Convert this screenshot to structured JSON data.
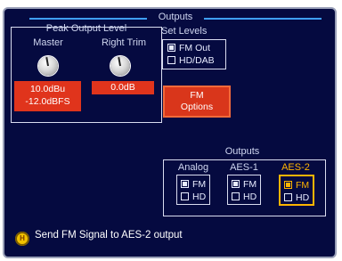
{
  "panel": {
    "title": "Outputs",
    "peak": {
      "title": "Peak Output Level",
      "master_label": "Master",
      "right_trim_label": "Right Trim",
      "master_dbu": "10.0dBu",
      "master_dbfs": "-12.0dBFS",
      "right_trim_value": "0.0dB"
    },
    "set_levels": {
      "title": "Set Levels",
      "options": [
        {
          "label": "FM Out",
          "checked": true
        },
        {
          "label": "HD/DAB",
          "checked": false
        }
      ]
    },
    "fm_options": {
      "line1": "FM",
      "line2": "Options"
    },
    "outputs": {
      "title": "Outputs",
      "columns": [
        {
          "label": "Analog",
          "fm": true,
          "hd": false,
          "selected": false
        },
        {
          "label": "AES-1",
          "fm": true,
          "hd": false,
          "selected": false
        },
        {
          "label": "AES-2",
          "fm": true,
          "hd": false,
          "selected": true
        }
      ],
      "fm_label": "FM",
      "hd_label": "HD"
    },
    "status": {
      "icon_letter": "H",
      "message": "Send FM Signal to AES-2 output"
    },
    "colors": {
      "background": "#050a40",
      "accent": "#3fa0ff",
      "value_red": "#e0341c",
      "selected_gold": "#ffb400"
    }
  }
}
